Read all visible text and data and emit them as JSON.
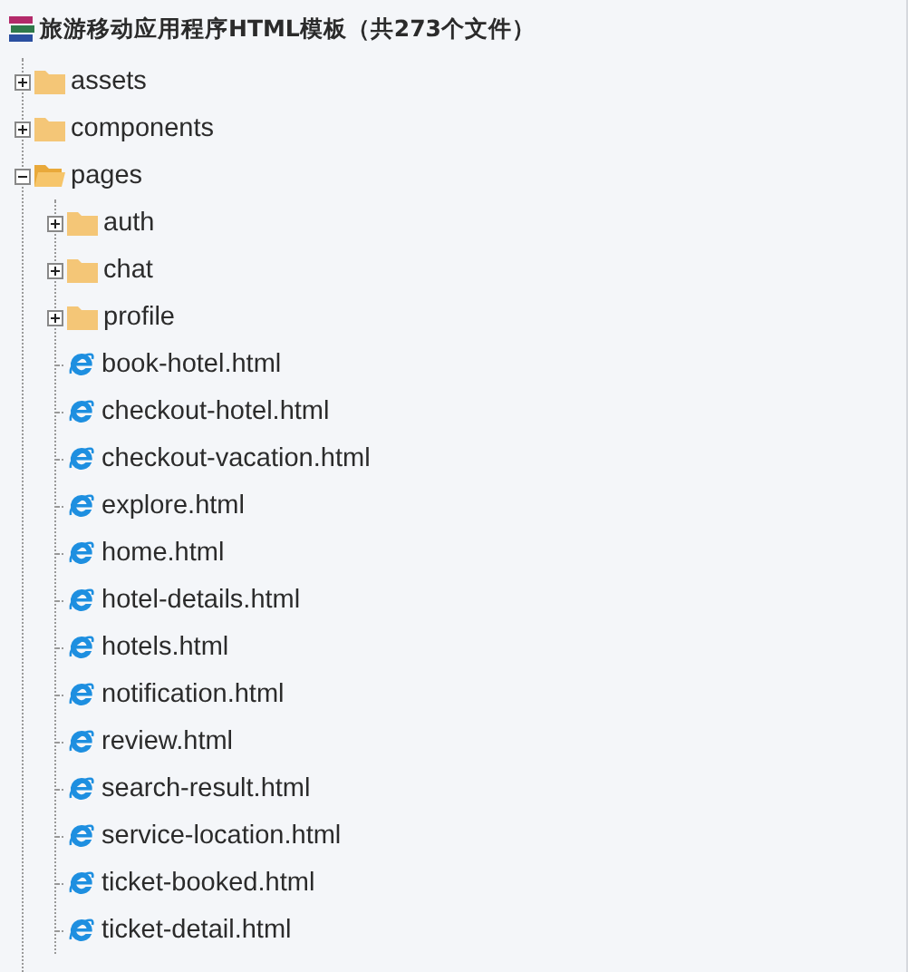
{
  "title": "旅游移动应用程序HTML模板（共273个文件）",
  "tree": [
    {
      "name": "assets",
      "kind": "folder",
      "expanded": false
    },
    {
      "name": "components",
      "kind": "folder",
      "expanded": false
    },
    {
      "name": "pages",
      "kind": "folder",
      "expanded": true,
      "children": [
        {
          "name": "auth",
          "kind": "folder",
          "expanded": false
        },
        {
          "name": "chat",
          "kind": "folder",
          "expanded": false
        },
        {
          "name": "profile",
          "kind": "folder",
          "expanded": false
        },
        {
          "name": "book-hotel.html",
          "kind": "file"
        },
        {
          "name": "checkout-hotel.html",
          "kind": "file"
        },
        {
          "name": "checkout-vacation.html",
          "kind": "file"
        },
        {
          "name": "explore.html",
          "kind": "file"
        },
        {
          "name": "home.html",
          "kind": "file"
        },
        {
          "name": "hotel-details.html",
          "kind": "file"
        },
        {
          "name": "hotels.html",
          "kind": "file"
        },
        {
          "name": "notification.html",
          "kind": "file"
        },
        {
          "name": "review.html",
          "kind": "file"
        },
        {
          "name": "search-result.html",
          "kind": "file"
        },
        {
          "name": "service-location.html",
          "kind": "file"
        },
        {
          "name": "ticket-booked.html",
          "kind": "file"
        },
        {
          "name": "ticket-detail.html",
          "kind": "file"
        }
      ]
    }
  ]
}
